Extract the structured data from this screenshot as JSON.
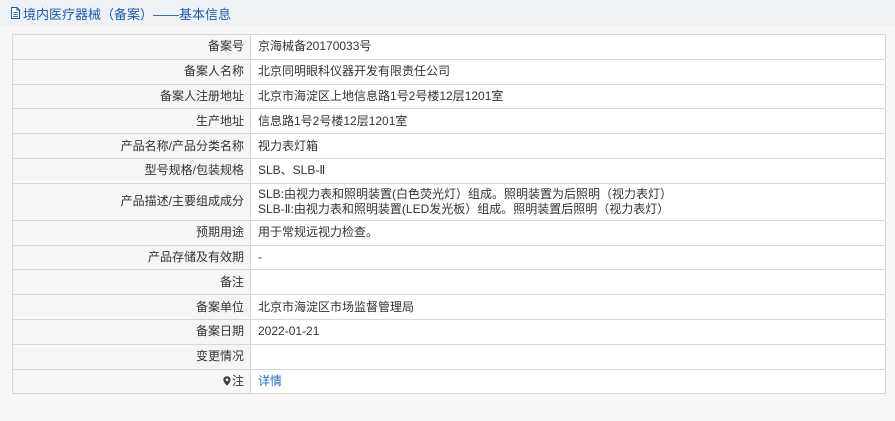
{
  "header": {
    "title": "境内医疗器械（备案）——基本信息",
    "icon": "document-icon",
    "color": "#1f5aa8"
  },
  "rows": [
    {
      "label": "备案号",
      "value": "京海械备20170033号"
    },
    {
      "label": "备案人名称",
      "value": "北京同明眼科仪器开发有限责任公司"
    },
    {
      "label": "备案人注册地址",
      "value": "北京市海淀区上地信息路1号2号楼12层1201室"
    },
    {
      "label": "生产地址",
      "value": "信息路1号2号楼12层1201室"
    },
    {
      "label": "产品名称/产品分类名称",
      "value": "视力表灯箱"
    },
    {
      "label": "型号规格/包装规格",
      "value": "SLB、SLB-Ⅱ"
    },
    {
      "label": "产品描述/主要组成成分",
      "value_lines": [
        "SLB:由视力表和照明装置(白色荧光灯）组成。照明装置为后照明（视力表灯）",
        "SLB-Ⅱ:由视力表和照明装置(LED发光板）组成。照明装置后照明（视力表灯）"
      ]
    },
    {
      "label": "预期用途",
      "value": "用于常规远视力检查。"
    },
    {
      "label": "产品存储及有效期",
      "value": "-"
    },
    {
      "label": "备注",
      "value": ""
    },
    {
      "label": "备案单位",
      "value": "北京市海淀区市场监督管理局"
    },
    {
      "label": "备案日期",
      "value": "2022-01-21"
    },
    {
      "label": "变更情况",
      "value": ""
    },
    {
      "label": "注",
      "label_icon": "location-pin-icon",
      "value": "详情",
      "link_color": "#1f6fc5"
    }
  ]
}
